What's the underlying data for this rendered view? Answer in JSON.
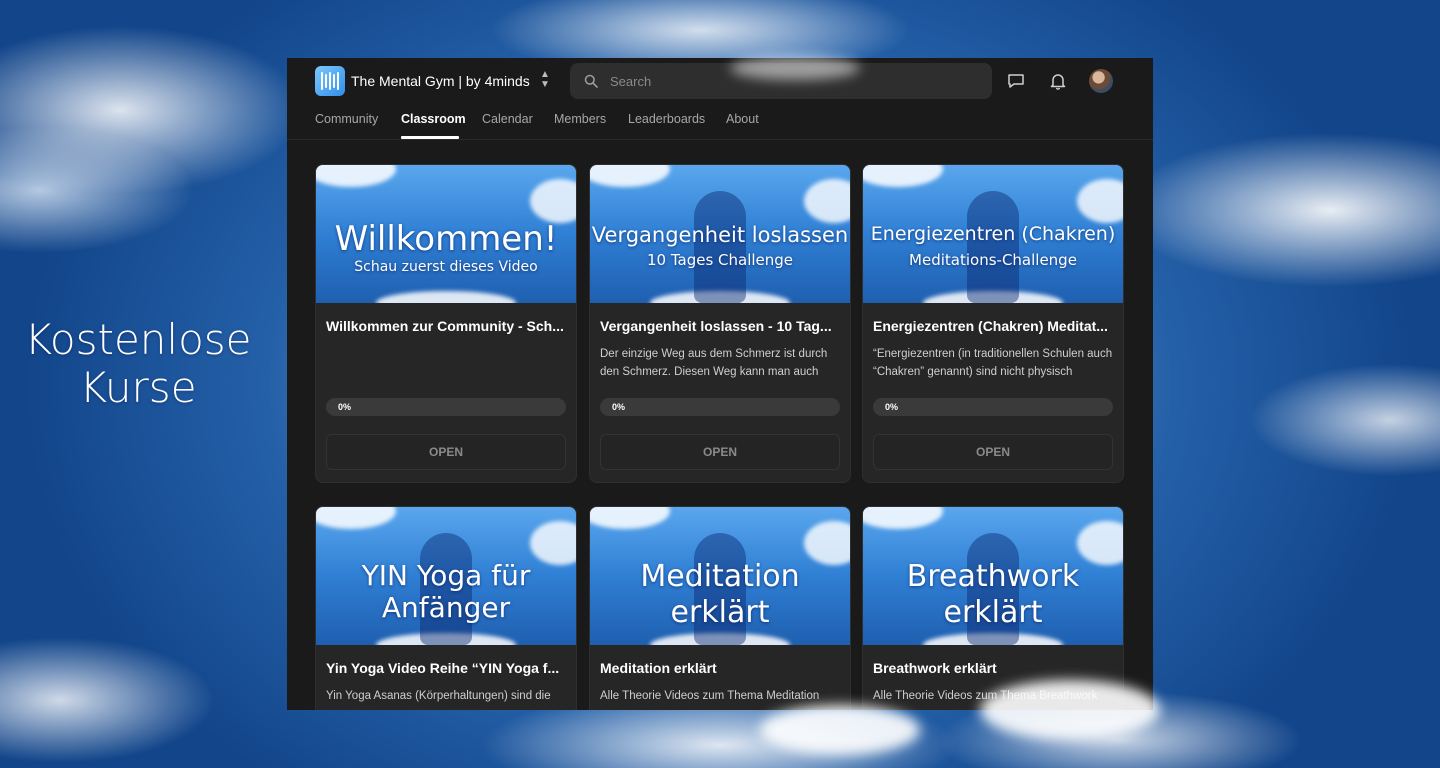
{
  "side_title": {
    "line1": "Kostenlose",
    "line2": "Kurse"
  },
  "header": {
    "app_title": "The Mental Gym | by 4minds",
    "search_placeholder": "Search"
  },
  "nav": {
    "tabs": [
      {
        "label": "Community"
      },
      {
        "label": "Classroom",
        "active": true
      },
      {
        "label": "Calendar"
      },
      {
        "label": "Members"
      },
      {
        "label": "Leaderboards"
      },
      {
        "label": "About"
      }
    ]
  },
  "courses": [
    {
      "thumb_line1": "Willkommen!",
      "thumb_line2": "Schau zuerst dieses Video",
      "title": "Willkommen zur Community - Sch...",
      "description": "",
      "progress": 0,
      "progress_label": "0%",
      "button": "OPEN"
    },
    {
      "thumb_line1": "Vergangenheit loslassen",
      "thumb_line2": "10 Tages Challenge",
      "title": "Vergangenheit loslassen - 10 Tag...",
      "description": "Der einzige Weg aus dem Schmerz ist durch den Schmerz. Diesen Weg kann man auch",
      "progress": 0,
      "progress_label": "0%",
      "button": "OPEN"
    },
    {
      "thumb_line1": "Energiezentren (Chakren)",
      "thumb_line2": "Meditations-Challenge",
      "title": "Energiezentren (Chakren) Meditat...",
      "description": "“Energiezentren (in traditionellen Schulen auch “Chakren” genannt) sind nicht physisch",
      "progress": 0,
      "progress_label": "0%",
      "button": "OPEN"
    },
    {
      "thumb_line1": "YIN Yoga für",
      "thumb_line2": "Anfänger",
      "title": "Yin Yoga Video Reihe “YIN Yoga f...",
      "description": "Yin Yoga Asanas (Körperhaltungen) sind die"
    },
    {
      "thumb_line1": "Meditation",
      "thumb_line2": "erklärt",
      "title": "Meditation erklärt",
      "description": "Alle Theorie Videos zum Thema Meditation"
    },
    {
      "thumb_line1": "Breathwork",
      "thumb_line2": "erklärt",
      "title": "Breathwork erklärt",
      "description": "Alle Theorie Videos zum Thema Breathwork"
    }
  ]
}
